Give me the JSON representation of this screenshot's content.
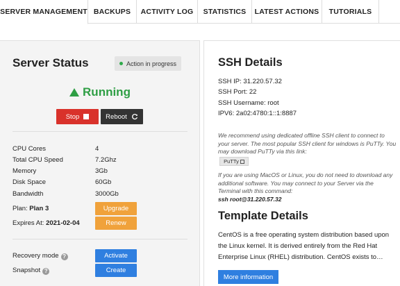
{
  "tabs": [
    {
      "label": "SERVER MANAGEMENT"
    },
    {
      "label": "BACKUPS"
    },
    {
      "label": "ACTIVITY LOG"
    },
    {
      "label": "STATISTICS"
    },
    {
      "label": "LATEST ACTIONS"
    },
    {
      "label": "TUTORIALS"
    }
  ],
  "server_status": {
    "title": "Server Status",
    "badge": "Action in progress",
    "state": "Running",
    "stop_label": "Stop",
    "reboot_label": "Reboot",
    "specs": [
      {
        "label": "CPU Cores",
        "value": "4"
      },
      {
        "label": "Total CPU Speed",
        "value": "7.2Ghz"
      },
      {
        "label": "Memory",
        "value": "3Gb"
      },
      {
        "label": "Disk Space",
        "value": "60Gb"
      },
      {
        "label": "Bandwidth",
        "value": "3000Gb"
      }
    ],
    "plan_label": "Plan:",
    "plan_value": "Plan 3",
    "upgrade_label": "Upgrade",
    "expires_label": "Expires At:",
    "expires_value": "2021-02-04",
    "renew_label": "Renew",
    "recovery_label": "Recovery mode",
    "activate_label": "Activate",
    "snapshot_label": "Snapshot",
    "create_label": "Create",
    "colors": {
      "running": "#2e9e44",
      "stop": "#d9322b",
      "reboot": "#333333",
      "orange": "#f0a23b",
      "blue": "#2f7fe0"
    }
  },
  "ssh": {
    "title": "SSH Details",
    "ip": "SSH IP: 31.220.57.32",
    "port": "SSH Port: 22",
    "username": "SSH Username: root",
    "ipv6": "IPV6: 2a02:4780:1::1:8887",
    "note1": "We recommend using dedicated offline SSH client to connect to your server. The most popular SSH client for windows is PuTTy. You may download PuTTy via this link:",
    "putty_label": "PuTTy",
    "note2": "If you are using MacOS or Linux, you do not need to download any additional software. You may connect to your Server via the Terminal with this command:",
    "command": "ssh root@31.220.57.32"
  },
  "template": {
    "title": "Template Details",
    "description": "CentOS is a free operating system distribution based upon the Linux kernel. It is derived entirely from the Red Hat Enterprise Linux (RHEL) distribution. CentOS exists to…",
    "more_label": "More information"
  }
}
